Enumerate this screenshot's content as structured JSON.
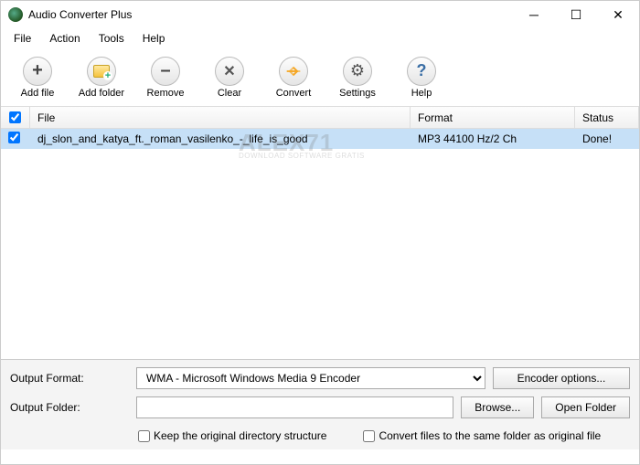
{
  "window": {
    "title": "Audio Converter Plus"
  },
  "menu": {
    "file": "File",
    "action": "Action",
    "tools": "Tools",
    "help": "Help"
  },
  "toolbar": {
    "add_file": "Add file",
    "add_folder": "Add folder",
    "remove": "Remove",
    "clear": "Clear",
    "convert": "Convert",
    "settings": "Settings",
    "help": "Help"
  },
  "columns": {
    "file": "File",
    "format": "Format",
    "status": "Status"
  },
  "rows": [
    {
      "checked": true,
      "file": "dj_slon_and_katya_ft._roman_vasilenko_-_life_is_good",
      "format": "MP3 44100 Hz/2 Ch",
      "status": "Done!"
    }
  ],
  "watermark": {
    "big": "ALEX71",
    "small": "DOWNLOAD SOFTWARE GRATIS"
  },
  "bottom": {
    "output_format_label": "Output Format:",
    "output_format_value": "WMA - Microsoft Windows Media 9 Encoder",
    "encoder_options": "Encoder options...",
    "output_folder_label": "Output Folder:",
    "output_folder_value": "",
    "browse": "Browse...",
    "open_folder": "Open Folder",
    "keep_structure": "Keep the original directory structure",
    "same_folder": "Convert files to the same folder as original file"
  }
}
